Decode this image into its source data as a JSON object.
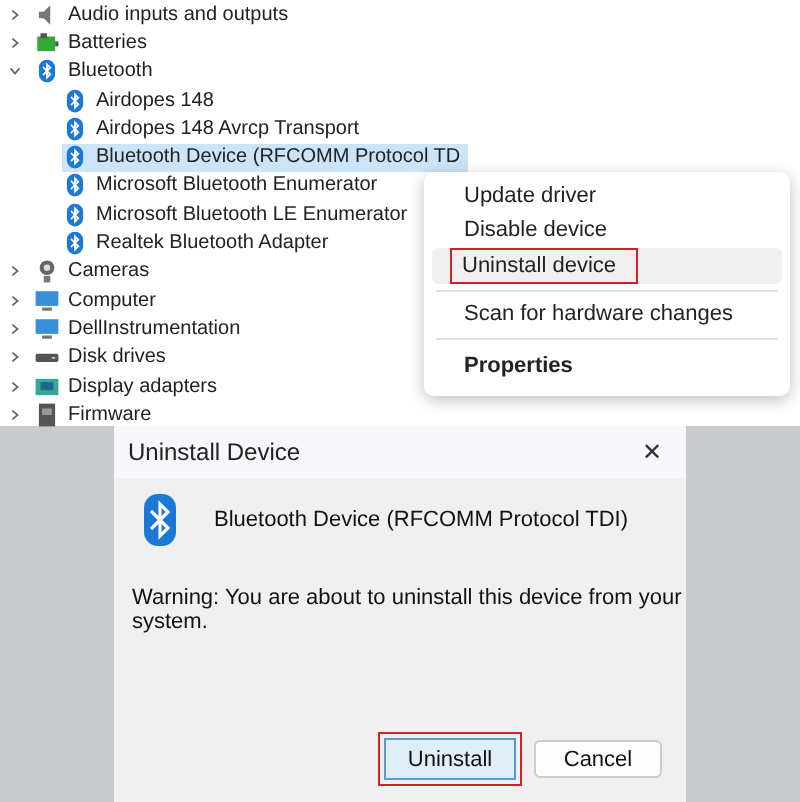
{
  "device_tree": [
    {
      "label": "Audio inputs and outputs",
      "kind": "audio",
      "expanded": false
    },
    {
      "label": "Batteries",
      "kind": "battery",
      "expanded": false
    },
    {
      "label": "Bluetooth",
      "kind": "bluetooth",
      "expanded": true,
      "children": [
        {
          "label": "Airdopes 148",
          "kind": "bluetooth",
          "selected": false
        },
        {
          "label": "Airdopes 148 Avrcp Transport",
          "kind": "bluetooth",
          "selected": false
        },
        {
          "label": "Bluetooth Device (RFCOMM Protocol TD",
          "kind": "bluetooth",
          "selected": true
        },
        {
          "label": "Microsoft Bluetooth Enumerator",
          "kind": "bluetooth",
          "selected": false
        },
        {
          "label": "Microsoft Bluetooth LE Enumerator",
          "kind": "bluetooth",
          "selected": false
        },
        {
          "label": "Realtek Bluetooth Adapter",
          "kind": "bluetooth",
          "selected": false
        }
      ]
    },
    {
      "label": "Cameras",
      "kind": "camera",
      "expanded": false
    },
    {
      "label": "Computer",
      "kind": "computer",
      "expanded": false
    },
    {
      "label": "DellInstrumentation",
      "kind": "computer",
      "expanded": false
    },
    {
      "label": "Disk drives",
      "kind": "disk",
      "expanded": false
    },
    {
      "label": "Display adapters",
      "kind": "display",
      "expanded": false
    },
    {
      "label": "Firmware",
      "kind": "firmware",
      "expanded": false
    }
  ],
  "context_menu": [
    {
      "label": "Update driver",
      "kind": "item",
      "highlighted": false
    },
    {
      "label": "Disable device",
      "kind": "item",
      "highlighted": false
    },
    {
      "label": "Uninstall device",
      "kind": "item",
      "highlighted": true
    },
    {
      "kind": "separator"
    },
    {
      "label": "Scan for hardware changes",
      "kind": "item",
      "highlighted": false
    },
    {
      "kind": "separator"
    },
    {
      "label": "Properties",
      "kind": "default",
      "highlighted": false
    }
  ],
  "dialog": {
    "title": "Uninstall Device",
    "close": "✕",
    "device": "Bluetooth Device (RFCOMM Protocol TDI)",
    "warning": "Warning: You are about to uninstall this device from your system.",
    "buttons": [
      {
        "label": "Uninstall",
        "default": true,
        "highlighted": true
      },
      {
        "label": "Cancel",
        "default": false,
        "highlighted": false
      }
    ]
  }
}
